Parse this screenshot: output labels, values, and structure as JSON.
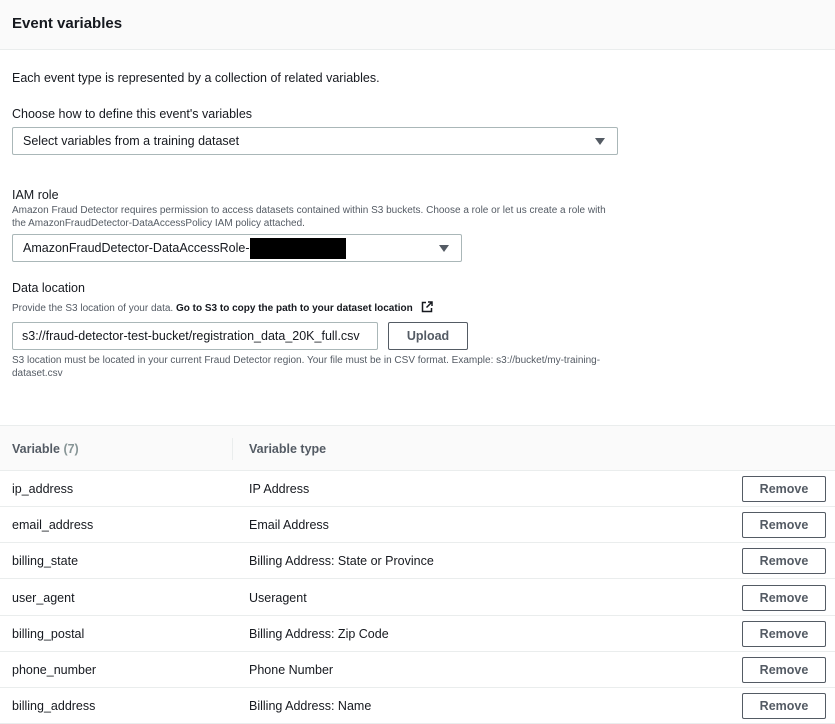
{
  "header": {
    "title": "Event variables"
  },
  "intro": "Each event type is represented by a collection of related variables.",
  "define": {
    "label": "Choose how to define this event's variables",
    "selected": "Select variables from a training dataset"
  },
  "iam": {
    "label": "IAM role",
    "description": "Amazon Fraud Detector requires permission to access datasets contained within S3 buckets. Choose a role or let us create a role with the AmazonFraudDetector-DataAccessPolicy IAM policy attached.",
    "selected": "AmazonFraudDetector-DataAccessRole-"
  },
  "data_location": {
    "label": "Data location",
    "description": "Provide the S3 location of your data.",
    "link": "Go to S3 to copy the path to your dataset location",
    "value": "s3://fraud-detector-test-bucket/registration_data_20K_full.csv",
    "upload_label": "Upload",
    "hint": "S3 location must be located in your current Fraud Detector region. Your file must be in CSV format. Example: s3://bucket/my-training-dataset.csv"
  },
  "table": {
    "col_variable": "Variable",
    "count": "(7)",
    "col_type": "Variable type",
    "remove_label": "Remove",
    "rows": [
      {
        "variable": "ip_address",
        "type": "IP Address"
      },
      {
        "variable": "email_address",
        "type": "Email Address"
      },
      {
        "variable": "billing_state",
        "type": "Billing Address: State or Province"
      },
      {
        "variable": "user_agent",
        "type": "Useragent"
      },
      {
        "variable": "billing_postal",
        "type": "Billing Address: Zip Code"
      },
      {
        "variable": "phone_number",
        "type": "Phone Number"
      },
      {
        "variable": "billing_address",
        "type": "Billing Address: Name"
      }
    ]
  },
  "icons": {
    "dropdown": "caret-down-icon",
    "external": "external-link-icon"
  }
}
